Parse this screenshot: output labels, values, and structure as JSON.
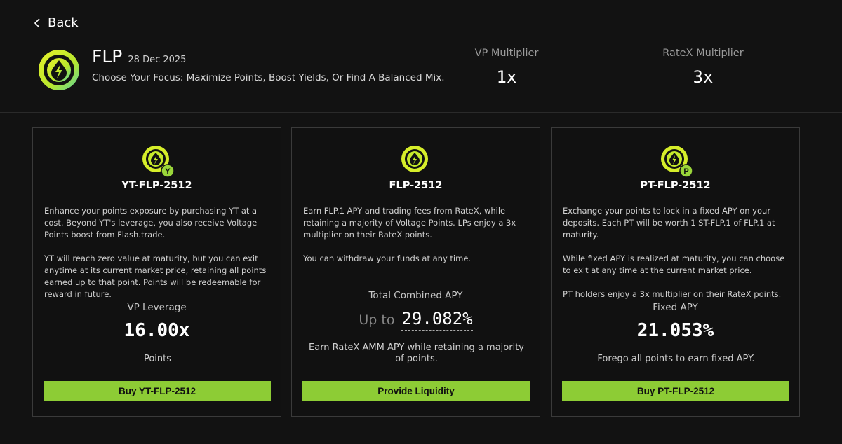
{
  "nav": {
    "back_label": "Back"
  },
  "header": {
    "title": "FLP",
    "date": "28 Dec 2025",
    "subtitle": "Choose Your Focus: Maximize Points, Boost Yields, Or Find A Balanced Mix.",
    "vp_multiplier_label": "VP Multiplier",
    "vp_multiplier_value": "1x",
    "ratex_multiplier_label": "RateX Multiplier",
    "ratex_multiplier_value": "3x"
  },
  "cards": [
    {
      "name": "YT-FLP-2512",
      "badge": "Y",
      "desc": [
        "Enhance your points exposure by purchasing YT at a cost. Beyond YT's leverage, you also receive Voltage Points boost from Flash.trade.",
        "YT will reach zero value at maturity, but you can exit anytime at its current market price, retaining all points earned up to that point. Points will be redeemable for reward in future."
      ],
      "metric_label": "VP Leverage",
      "metric_value": "16.00x",
      "footer": "Points",
      "button": "Buy YT-FLP-2512"
    },
    {
      "name": "FLP-2512",
      "desc": [
        "Earn FLP.1 APY and trading fees from RateX, while retaining a majority of Voltage Points. LPs enjoy a 3x multiplier on their RateX points.",
        "You can withdraw your funds at any time."
      ],
      "metric_label": "Total Combined APY",
      "metric_prefix": "Up to",
      "metric_value": "29.082%",
      "footer": "Earn RateX AMM APY while retaining a majority of points.",
      "button": "Provide Liquidity"
    },
    {
      "name": "PT-FLP-2512",
      "badge": "P",
      "desc": [
        "Exchange your points to lock in a fixed APY on your deposits. Each PT will be worth 1 ST-FLP.1 of FLP.1 at maturity.",
        "While fixed APY is realized at maturity, you can choose to exit at any time at the current market price.",
        "PT holders enjoy a 3x multiplier on their RateX points."
      ],
      "metric_label": "Fixed APY",
      "metric_value": "21.053%",
      "footer": "Forego all points to earn fixed APY.",
      "button": "Buy PT-FLP-2512"
    }
  ],
  "colors": {
    "accent": "#8dcc35",
    "background": "#121212",
    "card_border": "#3a3a3a"
  },
  "icons": {
    "back": "chevron-left-icon",
    "token": "lightning-drop-icon"
  }
}
